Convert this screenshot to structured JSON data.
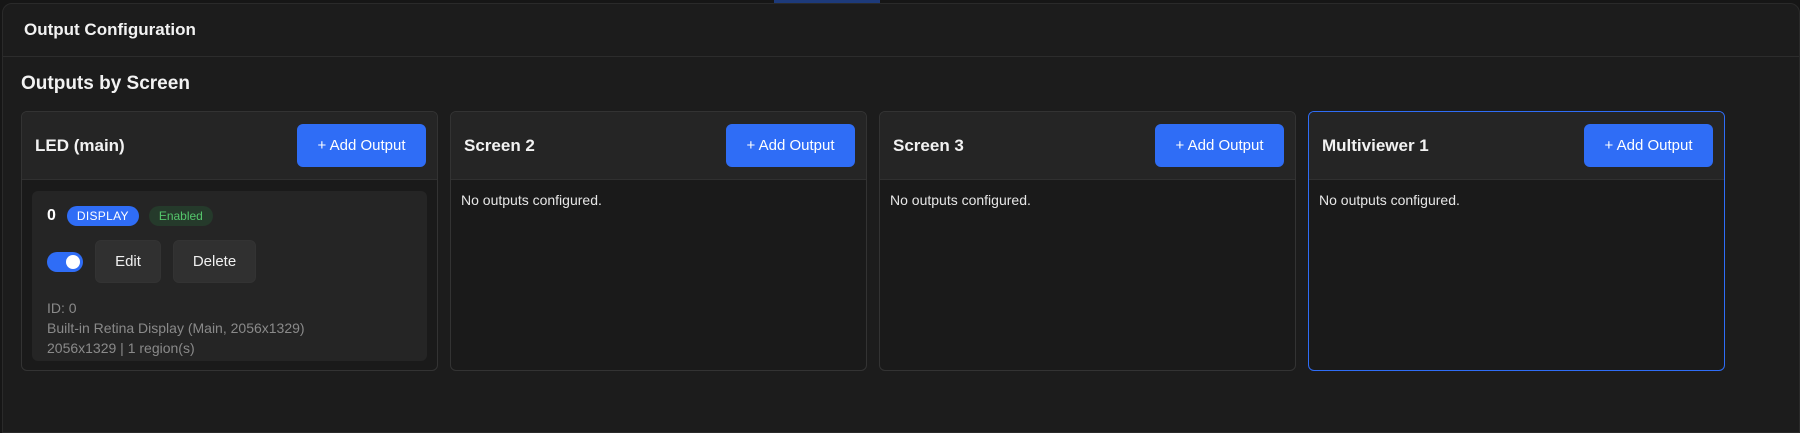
{
  "panel": {
    "title": "Output Configuration"
  },
  "section": {
    "title": "Outputs by Screen"
  },
  "screens": [
    {
      "name": "LED (main)",
      "add_label": "+ Add Output"
    },
    {
      "name": "Screen 2",
      "add_label": "+ Add Output",
      "empty_text": "No outputs configured."
    },
    {
      "name": "Screen 3",
      "add_label": "+ Add Output",
      "empty_text": "No outputs configured."
    },
    {
      "name": "Multiviewer 1",
      "add_label": "+ Add Output",
      "empty_text": "No outputs configured."
    }
  ],
  "output": {
    "number": "0",
    "type_badge": "DISPLAY",
    "status_badge": "Enabled",
    "toggle_on": true,
    "edit_label": "Edit",
    "delete_label": "Delete",
    "id_line": "ID: 0",
    "device_line": "Built-in Retina Display (Main, 2056x1329)",
    "resolution_line": "2056x1329 | 1 region(s)"
  },
  "colors": {
    "accent": "#2f6df6",
    "enabled_text": "#54c66b",
    "background": "#1c1c1c"
  }
}
